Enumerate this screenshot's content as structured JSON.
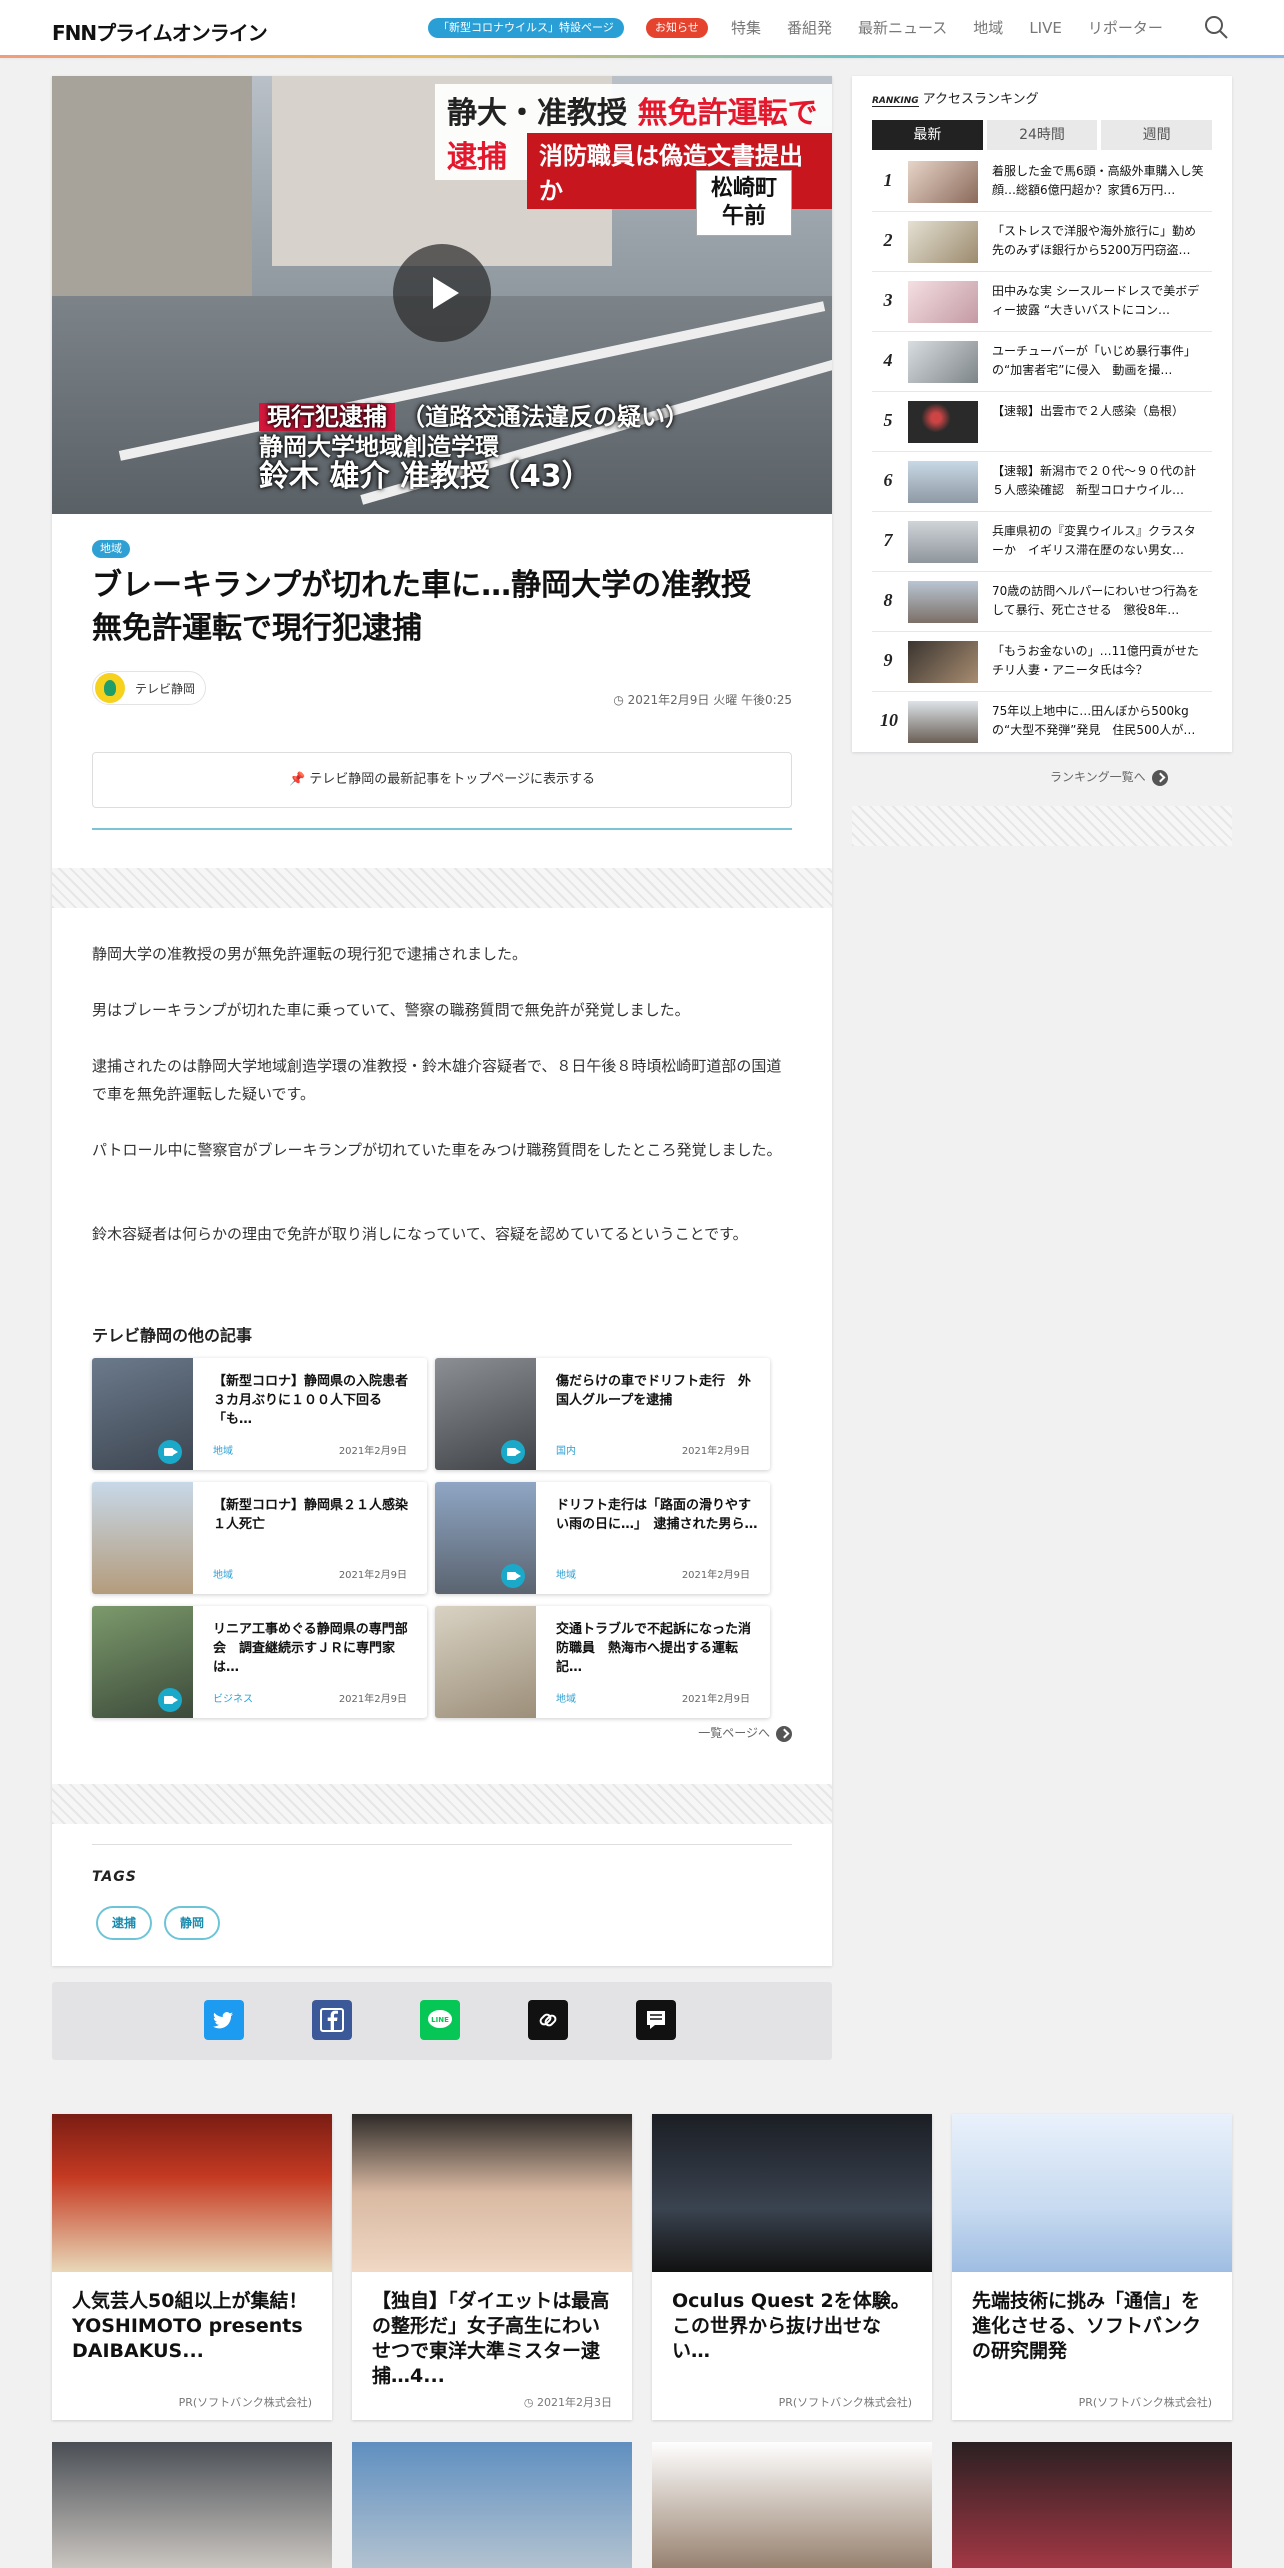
{
  "header": {
    "logo": "FNNプライムオンライン",
    "covid_pill": "「新型コロナウイルス」特設ページ",
    "notice_pill": "お知らせ",
    "nav": [
      "特集",
      "番組発",
      "最新ニュース",
      "地域",
      "LIVE",
      "リポーター"
    ]
  },
  "hero": {
    "caption_main_a": "静大・准教授",
    "caption_main_b": "無免許運転で逮捕",
    "caption_sub": "消防職員は偽造文書提出か",
    "caption_place": "松崎町",
    "caption_time": "午前",
    "caption_arrest_tag": "現行犯逮捕",
    "caption_arrest_reason": "（道路交通法違反の疑い）",
    "caption_org": "静岡大学地域創造学環",
    "caption_name": "鈴木 雄介 准教授（43）"
  },
  "article": {
    "category": "地域",
    "title": "ブレーキランプが切れた車に…静岡大学の准教授　無免許運転で現行犯逮捕",
    "source": "テレビ静岡",
    "date": "2021年2月9日 火曜 午後0:25",
    "follow_label": "テレビ静岡の最新記事をトップページに表示する",
    "paragraphs": [
      "静岡大学の准教授の男が無免許運転の現行犯で逮捕されました。",
      "男はブレーキランプが切れた車に乗っていて、警察の職務質問で無免許が発覚しました。",
      "逮捕されたのは静岡大学地域創造学環の准教授・鈴木雄介容疑者で、８日午後８時頃松崎町道部の国道で車を無免許運転した疑いです。",
      "パトロール中に警察官がブレーキランプが切れていた車をみつけ職務質問をしたところ発覚しました。",
      "鈴木容疑者は何らかの理由で免許が取り消しになっていて、容疑を認めていてるということです。"
    ]
  },
  "related": {
    "heading": "テレビ静岡の他の記事",
    "items": [
      {
        "title": "【新型コロナ】静岡県の入院患者３カ月ぶりに１００人下回る「も…",
        "category": "地域",
        "date": "2021年2月9日"
      },
      {
        "title": "傷だらけの車でドリフト走行　外国人グループを逮捕",
        "category": "国内",
        "date": "2021年2月9日"
      },
      {
        "title": "【新型コロナ】静岡県２１人感染　１人死亡",
        "category": "地域",
        "date": "2021年2月9日"
      },
      {
        "title": "ドリフト走行は「路面の滑りやすい雨の日に…」　逮捕された男ら…",
        "category": "地域",
        "date": "2021年2月9日"
      },
      {
        "title": "リニア工事めぐる静岡県の専門部会　調査継続示すＪＲに専門家は…",
        "category": "ビジネス",
        "date": "2021年2月9日"
      },
      {
        "title": "交通トラブルで不起訴になった消防職員　熱海市へ提出する運転記…",
        "category": "地域",
        "date": "2021年2月9日"
      }
    ],
    "more_label": "一覧ページへ"
  },
  "tags": {
    "heading": "TAGS",
    "items": [
      "逮捕",
      "静岡"
    ]
  },
  "share": [
    "twitter-icon",
    "facebook-icon",
    "line-icon",
    "link-icon",
    "comment-icon"
  ],
  "ranking": {
    "badge": "RANKING",
    "heading": "アクセスランキング",
    "tabs": [
      "最新",
      "24時間",
      "週間"
    ],
    "items": [
      {
        "rank": "1",
        "title": "着服した金で馬6頭・高級外車購入し笑顔…総額6億円超か？家賃6万円…"
      },
      {
        "rank": "2",
        "title": "「ストレスで洋服や海外旅行に」勤め先のみずほ銀行から5200万円窃盗…"
      },
      {
        "rank": "3",
        "title": "田中みな実 シースルードレスで美ボディー披露 “大きいバストにコン…"
      },
      {
        "rank": "4",
        "title": "ユーチューバーが「いじめ暴行事件」の“加害者宅”に侵入　動画を撮…"
      },
      {
        "rank": "5",
        "title": "【速報】出雲市で２人感染（島根）"
      },
      {
        "rank": "6",
        "title": "【速報】新潟市で２０代～９０代の計５人感染確認　新型コロナウイル…"
      },
      {
        "rank": "7",
        "title": "兵庫県初の『変異ウイルス』クラスターか　イギリス滞在歴のない男女…"
      },
      {
        "rank": "8",
        "title": "70歳の訪問ヘルパーにわいせつ行為をして暴行、死亡させる　懲役8年…"
      },
      {
        "rank": "9",
        "title": "「もうお金ないの」…11億円貢がせたチリ人妻・アニータ氏は今？"
      },
      {
        "rank": "10",
        "title": "75年以上地中に…田んぼから500kgの“大型不発弾”発見　住民500人が…"
      }
    ],
    "all_link": "ランキング一覧へ"
  },
  "bottom": [
    {
      "title": "人気芸人50組以上が集結！YOSHIMOTO presents DAIBAKUS...",
      "sub": "PR(ソフトバンク株式会社)"
    },
    {
      "title": "【独自】「ダイエットは最高の整形だ」女子高生にわいせつで東洋大準ミスター逮捕…4...",
      "sub": "2021年2月3日"
    },
    {
      "title": "Oculus Quest 2を体験。この世界から抜け出せない…",
      "sub": "PR(ソフトバンク株式会社)"
    },
    {
      "title": "先端技術に挑み「通信」を進化させる、ソフトバンクの研究開発",
      "sub": "PR(ソフトバンク株式会社)"
    }
  ],
  "colors": {
    "accent": "#2ea0d4",
    "notice": "#e5432e",
    "tag_border": "#6ec4d7"
  }
}
